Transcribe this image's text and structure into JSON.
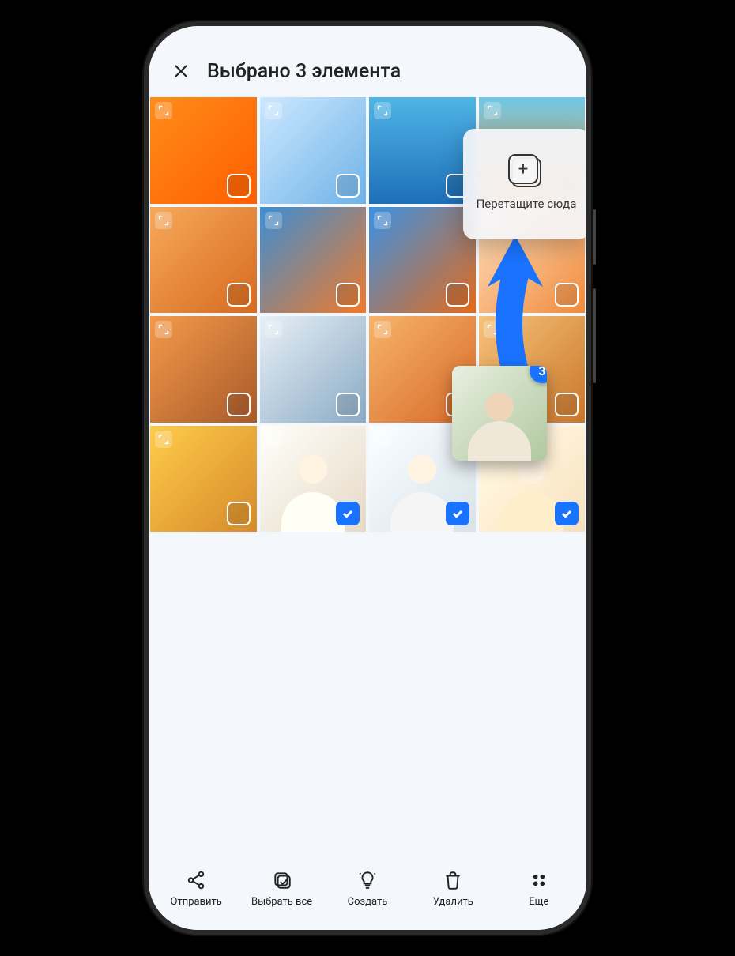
{
  "header": {
    "title": "Выбрано 3 элемента"
  },
  "dropzone": {
    "label": "Перетащите сюда"
  },
  "drag_badge": "3",
  "grid": [
    {
      "g": "g-orange",
      "sel": false
    },
    {
      "g": "g-snow",
      "sel": false
    },
    {
      "g": "g-sea",
      "sel": false
    },
    {
      "g": "g-beach",
      "sel": false
    },
    {
      "g": "g-desert",
      "sel": false
    },
    {
      "g": "g-city",
      "sel": false
    },
    {
      "g": "g-arch",
      "sel": false
    },
    {
      "g": "g-deck",
      "sel": false
    },
    {
      "g": "g-canyon",
      "sel": false
    },
    {
      "g": "g-mtn",
      "sel": false
    },
    {
      "g": "g-lounge",
      "sel": false
    },
    {
      "g": "g-tent",
      "sel": false
    },
    {
      "g": "g-field",
      "sel": false
    },
    {
      "g": "g-p1",
      "sel": true,
      "faded": true,
      "portrait": "p1"
    },
    {
      "g": "g-p2",
      "sel": true,
      "faded": true,
      "portrait": "p2"
    },
    {
      "g": "g-p3",
      "sel": true,
      "faded": true,
      "portrait": "p3"
    }
  ],
  "bottom": {
    "send": "Отправить",
    "selectall": "Выбрать все",
    "create": "Создать",
    "delete": "Удалить",
    "more": "Еще"
  }
}
